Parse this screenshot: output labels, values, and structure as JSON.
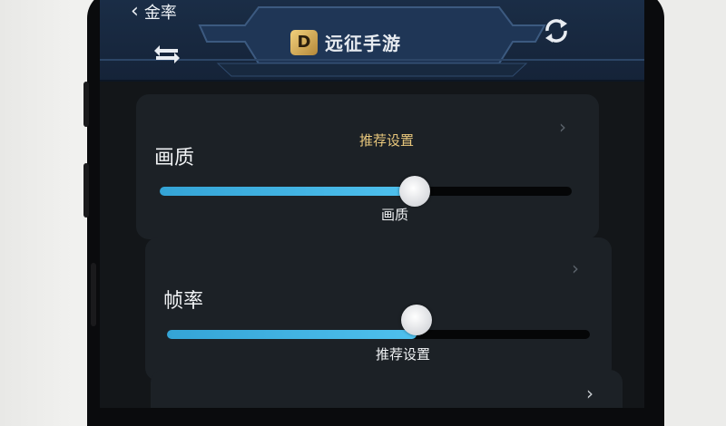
{
  "header": {
    "back_label": "金率",
    "brand_title": "远征手游",
    "brand_logo_glyph": "D",
    "accent": "#f2d17c"
  },
  "quality_card": {
    "title": "画质",
    "top_label": "推荐设置",
    "bottom_label": "画质",
    "slider_value_fraction": 0.62
  },
  "framerate_card": {
    "title": "帧率",
    "bottom_label": "推荐设置",
    "slider_value_fraction": 0.59
  },
  "colors": {
    "slider_fill": "#4fc1ee",
    "card_bg": "#1c2126",
    "header_bg": "#1a2d46"
  }
}
